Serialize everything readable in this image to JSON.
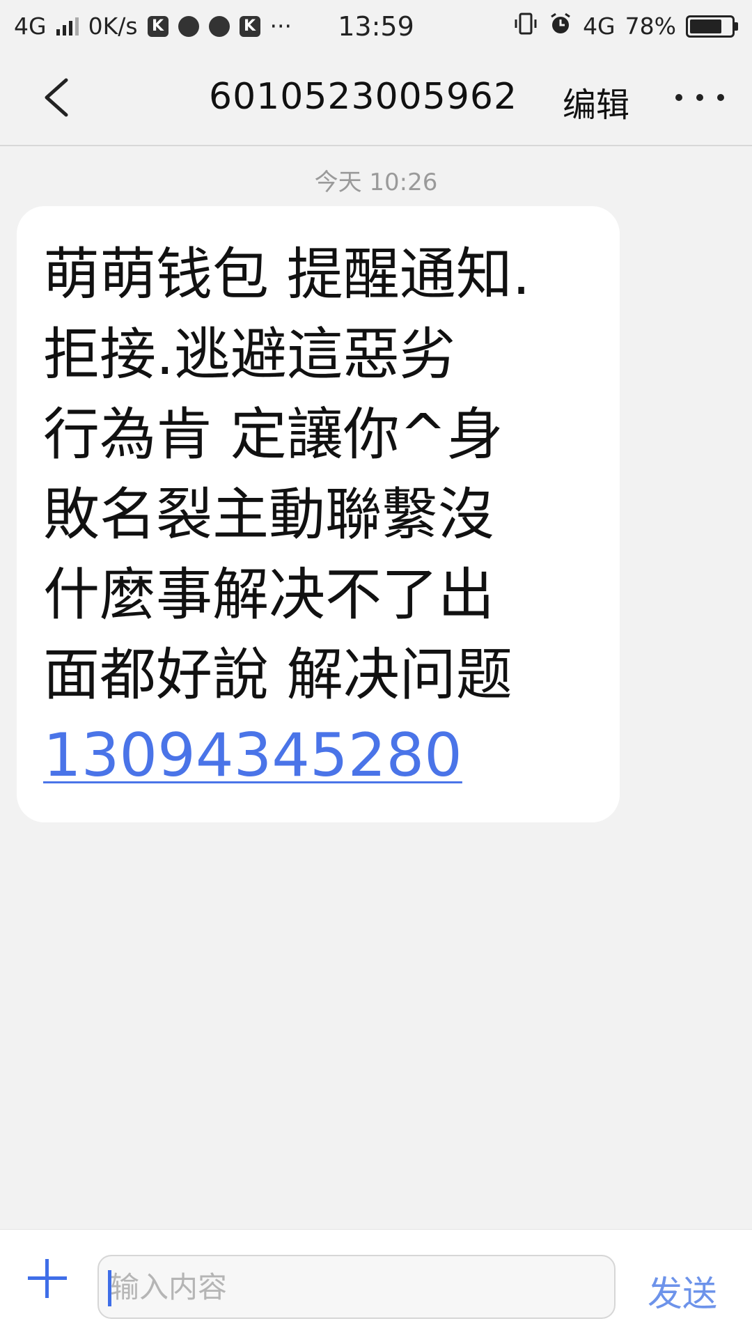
{
  "status_bar": {
    "network": "4G",
    "speed": "0K/s",
    "app_badge_1": "K",
    "app_badge_2": "K",
    "overflow": "···",
    "time": "13:59",
    "network_right": "4G",
    "battery_percent": "78%",
    "battery_level": 0.78
  },
  "header": {
    "title": "6010523005962",
    "edit_label": "编辑"
  },
  "conversation": {
    "timestamp": "今天 10:26",
    "message_lines": [
      "萌萌钱包 提醒通知.",
      "拒接.逃避這惡劣",
      "行為肯 定讓你^身",
      "敗名裂主動聯繫沒",
      "什麼事解决不了出",
      "面都好說 解决问题"
    ],
    "message_link": "13094345280"
  },
  "composer": {
    "placeholder": "输入内容",
    "send_label": "发送"
  },
  "colors": {
    "accent": "#3f6ee8",
    "link": "#4a74e8",
    "background": "#f2f2f2",
    "bubble": "#ffffff"
  }
}
